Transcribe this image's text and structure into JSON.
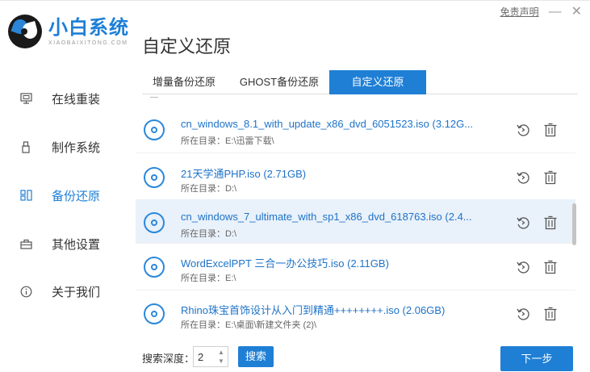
{
  "window": {
    "disclaimer": "免责声明",
    "minimize": "—",
    "close": "✕"
  },
  "brand": {
    "name": "小白系统",
    "subtitle": "XIAOBAIXITONG.COM",
    "accent": "#1e7fd6"
  },
  "page_title": "自定义还原",
  "sidebar": {
    "items": [
      {
        "label": "在线重装",
        "icon": "monitor-icon",
        "active": false
      },
      {
        "label": "制作系统",
        "icon": "usb-icon",
        "active": false
      },
      {
        "label": "备份还原",
        "icon": "backup-icon",
        "active": true
      },
      {
        "label": "其他设置",
        "icon": "briefcase-icon",
        "active": false
      },
      {
        "label": "关于我们",
        "icon": "info-icon",
        "active": false
      }
    ]
  },
  "tabs": [
    {
      "label": "增量备份还原",
      "active": false
    },
    {
      "label": "GHOST备份还原",
      "active": false
    },
    {
      "label": "自定义还原",
      "active": true
    }
  ],
  "files": [
    {
      "name": "cn_windows_8.1_with_update_x86_dvd_6051523.iso (3.12G...",
      "path": "所在目录：E:\\迅雷下载\\",
      "selected": false
    },
    {
      "name": "21天学通PHP.iso (2.71GB)",
      "path": "所在目录：D:\\",
      "selected": false
    },
    {
      "name": "cn_windows_7_ultimate_with_sp1_x86_dvd_618763.iso (2.4...",
      "path": "所在目录：D:\\",
      "selected": true
    },
    {
      "name": "WordExcelPPT 三合一办公技巧.iso (2.11GB)",
      "path": "所在目录：E:\\",
      "selected": false
    },
    {
      "name": "Rhino珠宝首饰设计从入门到精通++++++++.iso (2.06GB)",
      "path": "所在目录：E:\\桌面\\新建文件夹 (2)\\",
      "selected": false
    }
  ],
  "footer": {
    "depth_label": "搜索深度：",
    "depth_value": "2",
    "search_label": "搜索",
    "next_label": "下一步"
  }
}
